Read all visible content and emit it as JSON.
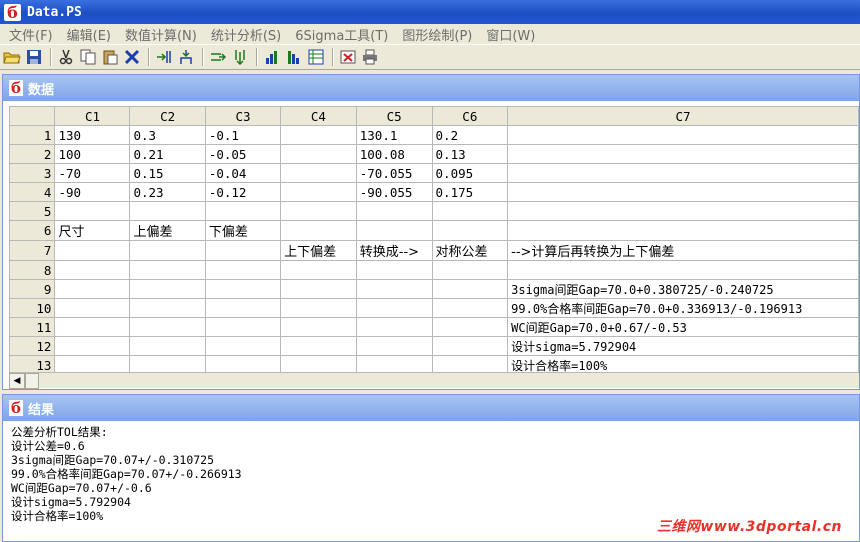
{
  "app": {
    "title": "Data.PS"
  },
  "menu": [
    "文件(F)",
    "编辑(E)",
    "数值计算(N)",
    "统计分析(S)",
    "6Sigma工具(T)",
    "图形绘制(P)",
    "窗口(W)"
  ],
  "data_window": {
    "title": "数据",
    "columns": [
      "C1",
      "C2",
      "C3",
      "C4",
      "C5",
      "C6",
      "C7"
    ],
    "rows": [
      [
        "1",
        "130",
        "0.3",
        "-0.1",
        "",
        "130.1",
        "0.2",
        ""
      ],
      [
        "2",
        "100",
        "0.21",
        "-0.05",
        "",
        "100.08",
        "0.13",
        ""
      ],
      [
        "3",
        "-70",
        "0.15",
        "-0.04",
        "",
        "-70.055",
        "0.095",
        ""
      ],
      [
        "4",
        "-90",
        "0.23",
        "-0.12",
        "",
        "-90.055",
        "0.175",
        ""
      ],
      [
        "5",
        "",
        "",
        "",
        "",
        "",
        "",
        ""
      ],
      [
        "6",
        "尺寸",
        "上偏差",
        "下偏差",
        "",
        "",
        "",
        ""
      ],
      [
        "7",
        "",
        "",
        "",
        "上下偏差",
        "转换成-->",
        "对称公差",
        "-->计算后再转换为上下偏差"
      ],
      [
        "8",
        "",
        "",
        "",
        "",
        "",
        "",
        ""
      ],
      [
        "9",
        "",
        "",
        "",
        "",
        "",
        "",
        "3sigma间距Gap=70.0+0.380725/-0.240725"
      ],
      [
        "10",
        "",
        "",
        "",
        "",
        "",
        "",
        "99.0%合格率间距Gap=70.0+0.336913/-0.196913"
      ],
      [
        "11",
        "",
        "",
        "",
        "",
        "",
        "",
        "WC间距Gap=70.0+0.67/-0.53"
      ],
      [
        "12",
        "",
        "",
        "",
        "",
        "",
        "",
        "设计sigma=5.792904"
      ],
      [
        "13",
        "",
        "",
        "",
        "",
        "",
        "",
        "设计合格率=100%"
      ]
    ]
  },
  "results_window": {
    "title": "结果",
    "lines": [
      "公差分析TOL结果:",
      "设计公差=0.6",
      "3sigma间距Gap=70.07+/-0.310725",
      "99.0%合格率间距Gap=70.07+/-0.266913",
      "WC间距Gap=70.07+/-0.6",
      "设计sigma=5.792904",
      "设计合格率=100%"
    ]
  },
  "watermark": "三维网www.3dportal.cn",
  "colors": {
    "titlebar": "#1d4fc4",
    "subwindow_title": "#7ea5e8",
    "logo": "#d42020",
    "watermark": "#e8322a"
  }
}
